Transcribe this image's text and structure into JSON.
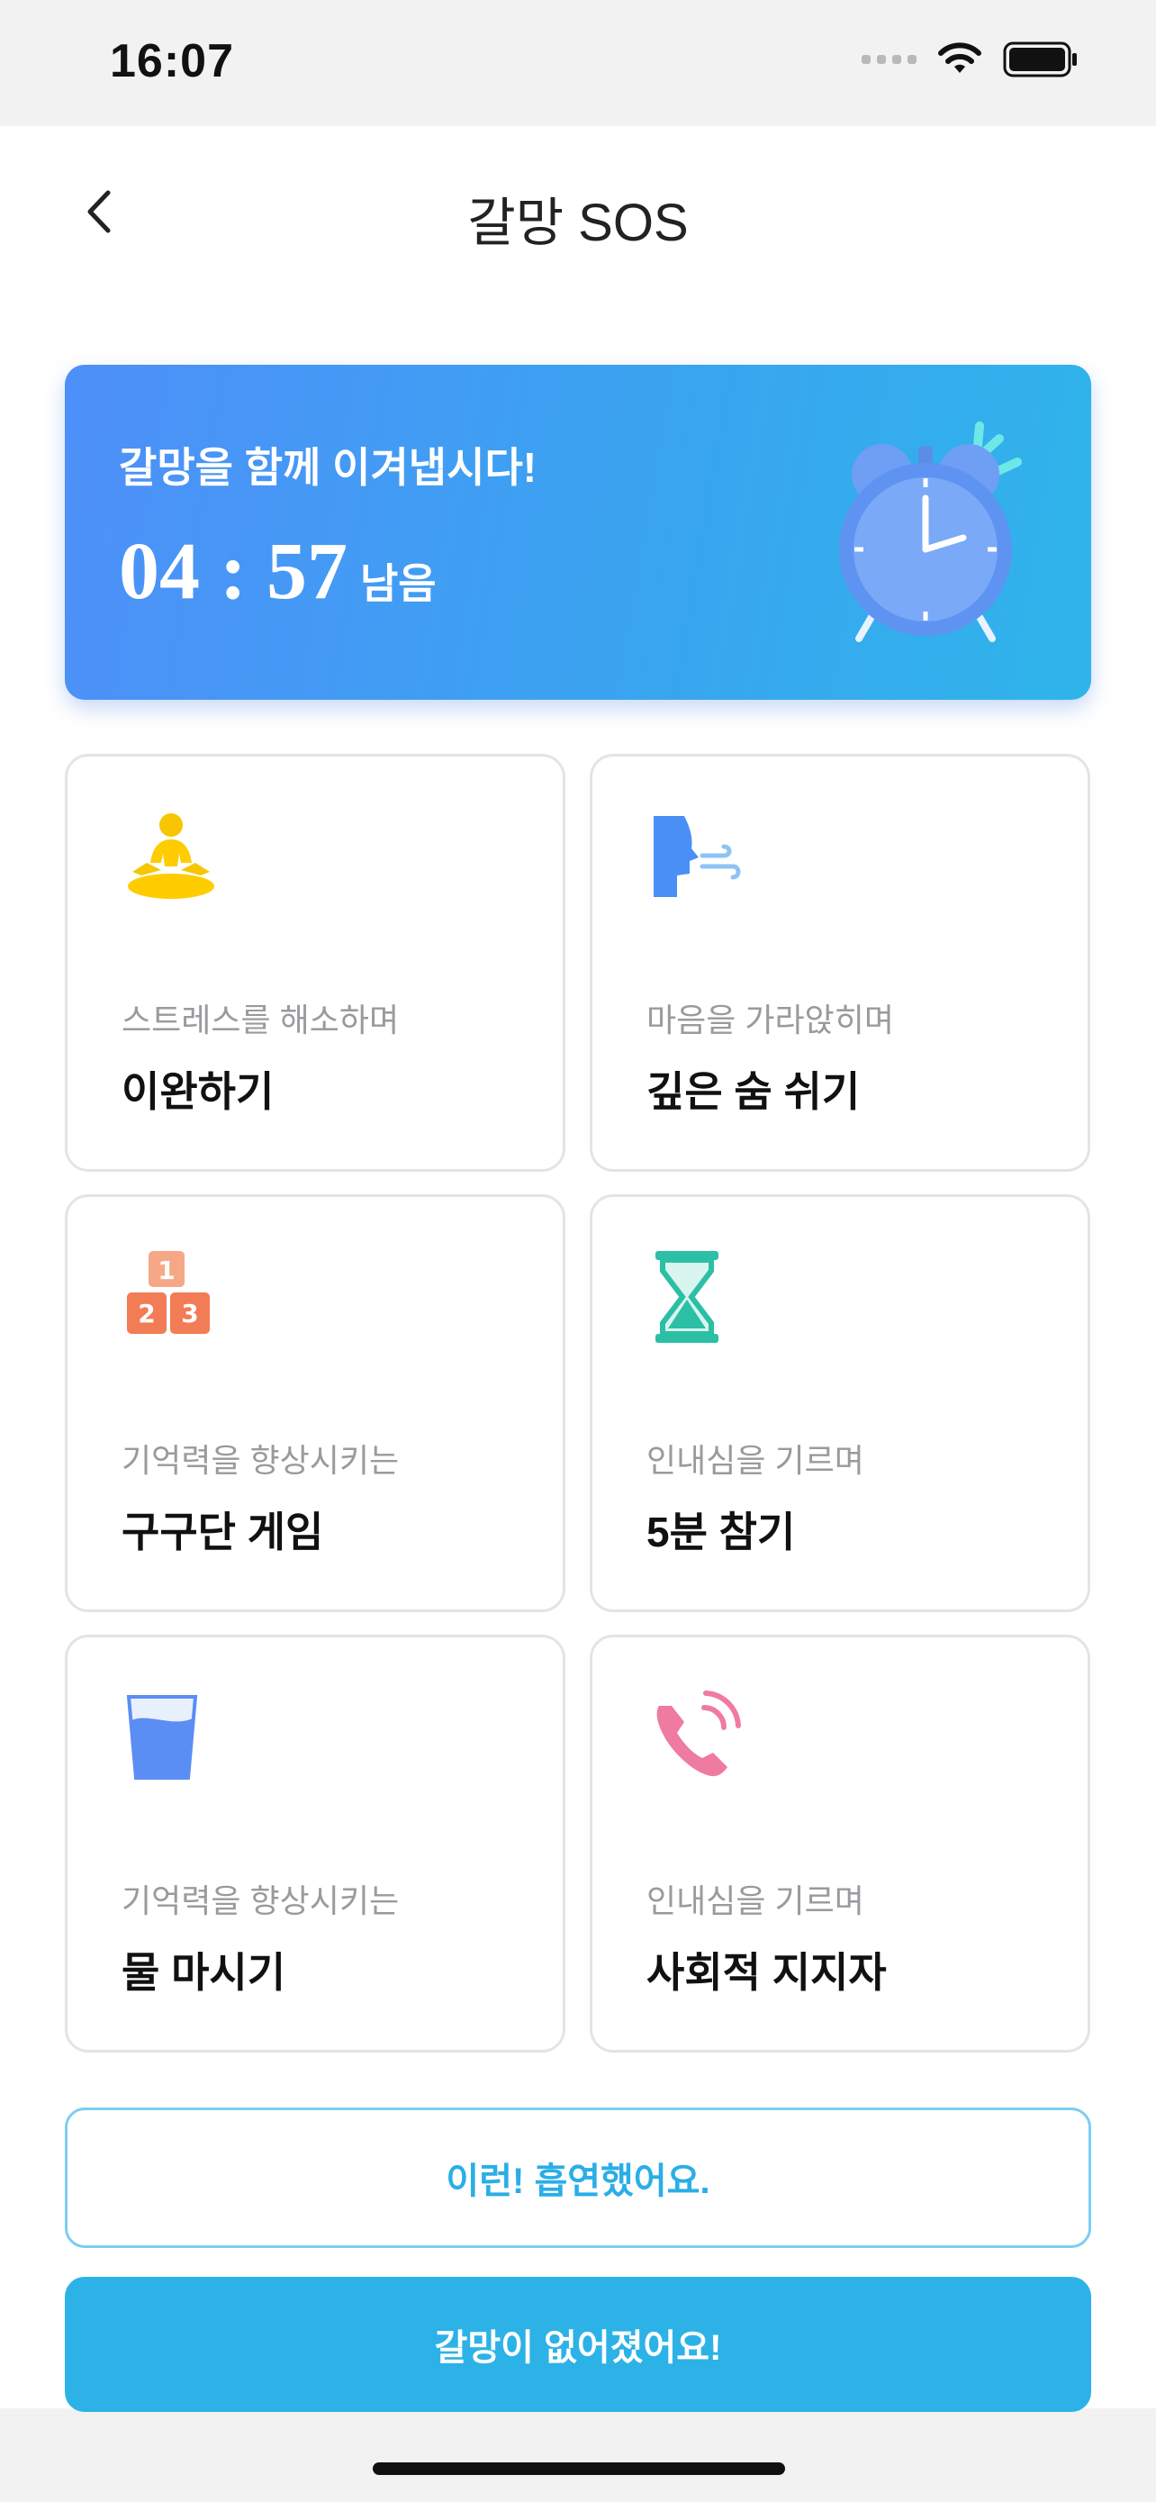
{
  "status_bar": {
    "time": "16:07"
  },
  "header": {
    "title": "갈망 SOS"
  },
  "banner": {
    "message": "갈망을 함께 이겨냅시다!",
    "minutes": "04",
    "separator": ":",
    "seconds": "57",
    "suffix": "남음"
  },
  "cards": [
    {
      "subtitle": "스트레스를 해소하며",
      "title": "이완하기",
      "icon": "meditation-icon"
    },
    {
      "subtitle": "마음을 가라앉히며",
      "title": "깊은 숨 쉬기",
      "icon": "breathing-icon"
    },
    {
      "subtitle": "기억력을 향상시키는",
      "title": "구구단 게임",
      "icon": "number-blocks-icon"
    },
    {
      "subtitle": "인내심을 기르며",
      "title": "5분 참기",
      "icon": "hourglass-icon"
    },
    {
      "subtitle": "기억력을 향상시키는",
      "title": "물 마시기",
      "icon": "water-glass-icon"
    },
    {
      "subtitle": "인내심을 기르며",
      "title": "사회적 지지자",
      "icon": "phone-call-icon"
    }
  ],
  "buttons": {
    "smoked_label": "이런! 흡연했어요.",
    "craving_gone_label": "갈망이 없어졌어요!"
  },
  "colors": {
    "accent": "#2db2e7",
    "banner_start": "#4e8ff9",
    "banner_end": "#2fb4ea"
  }
}
